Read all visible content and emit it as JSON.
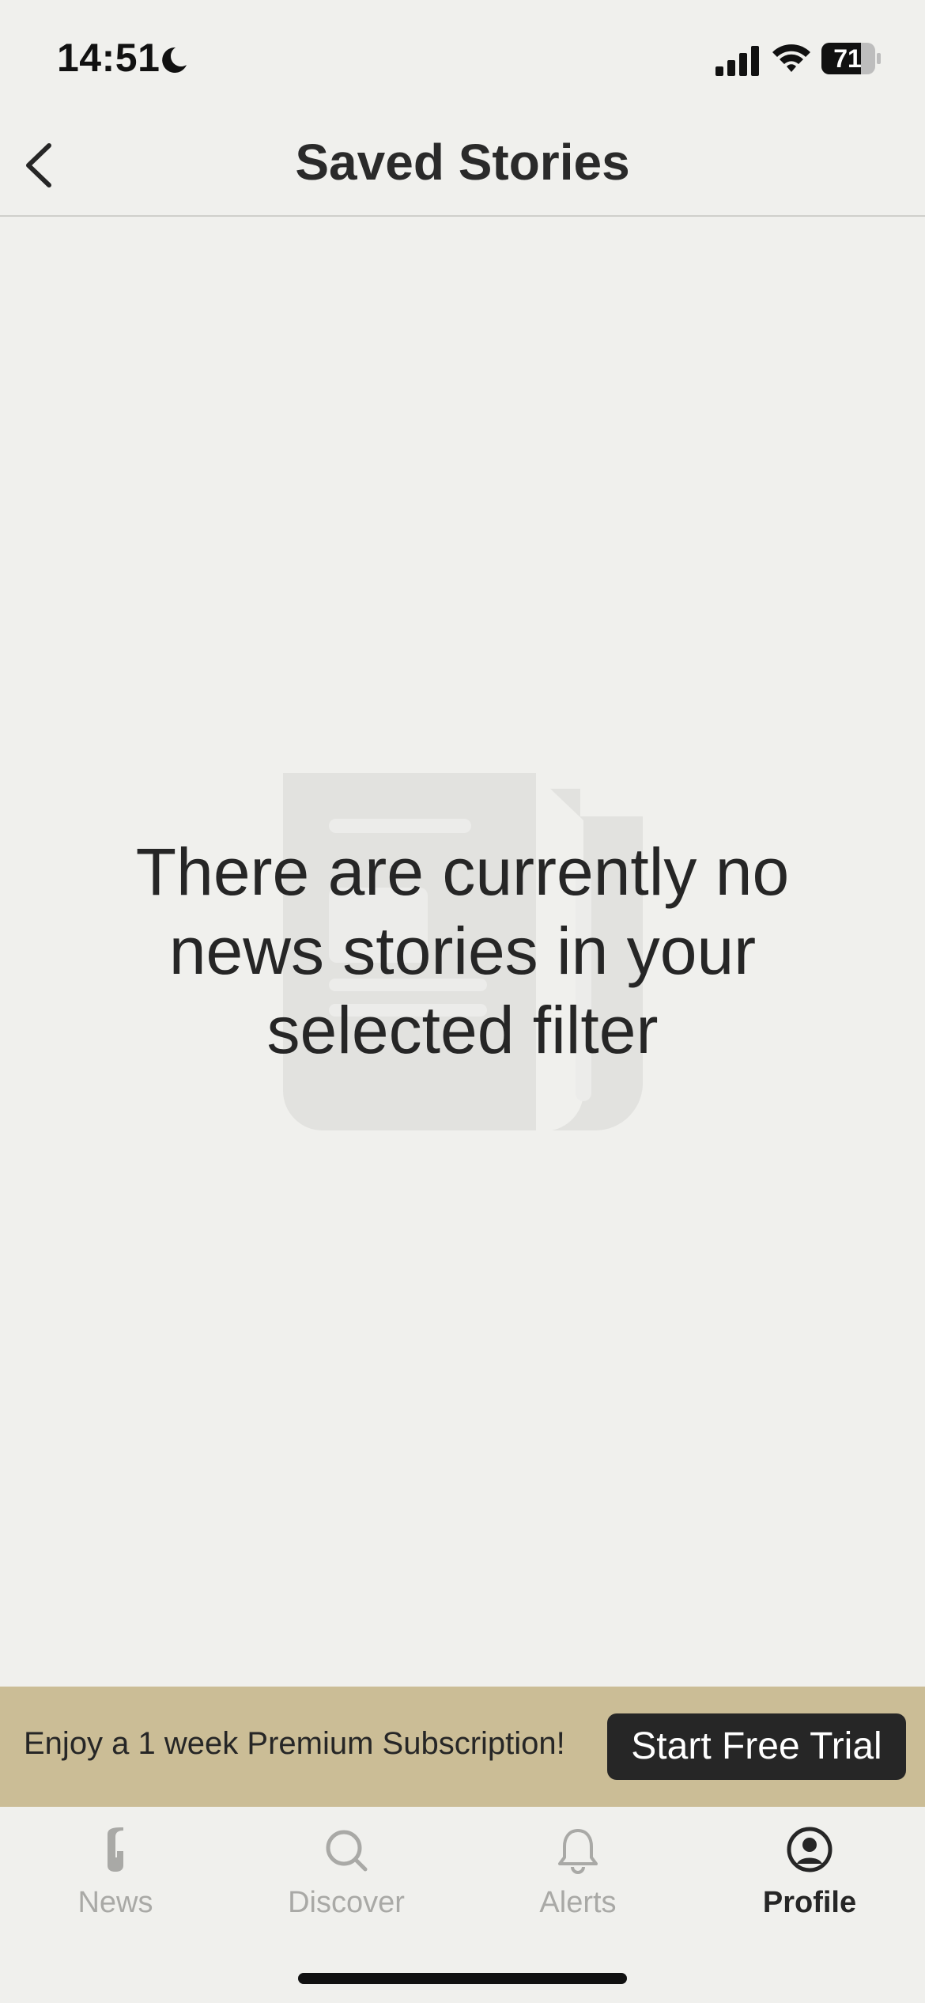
{
  "status_bar": {
    "time": "14:51",
    "battery": "71",
    "icons": [
      "moon-icon",
      "signal-icon",
      "wifi-icon",
      "battery-icon"
    ]
  },
  "nav": {
    "title": "Saved Stories",
    "back_icon": "chevron-left-icon"
  },
  "empty_state": {
    "message": "There are currently no news stories in your selected filter",
    "illustration": "newspaper-icon"
  },
  "promo": {
    "text": "Enjoy a 1 week Premium Subscription!",
    "button_label": "Start Free Trial"
  },
  "tabs": [
    {
      "label": "News",
      "icon": "news-logo-icon",
      "active": false
    },
    {
      "label": "Discover",
      "icon": "search-icon",
      "active": false
    },
    {
      "label": "Alerts",
      "icon": "bell-icon",
      "active": false
    },
    {
      "label": "Profile",
      "icon": "profile-icon",
      "active": true
    }
  ],
  "colors": {
    "background": "#f0f0ed",
    "promo_background": "#cbbd96",
    "text_dark": "#262626",
    "tab_inactive": "#a9a9a6"
  }
}
